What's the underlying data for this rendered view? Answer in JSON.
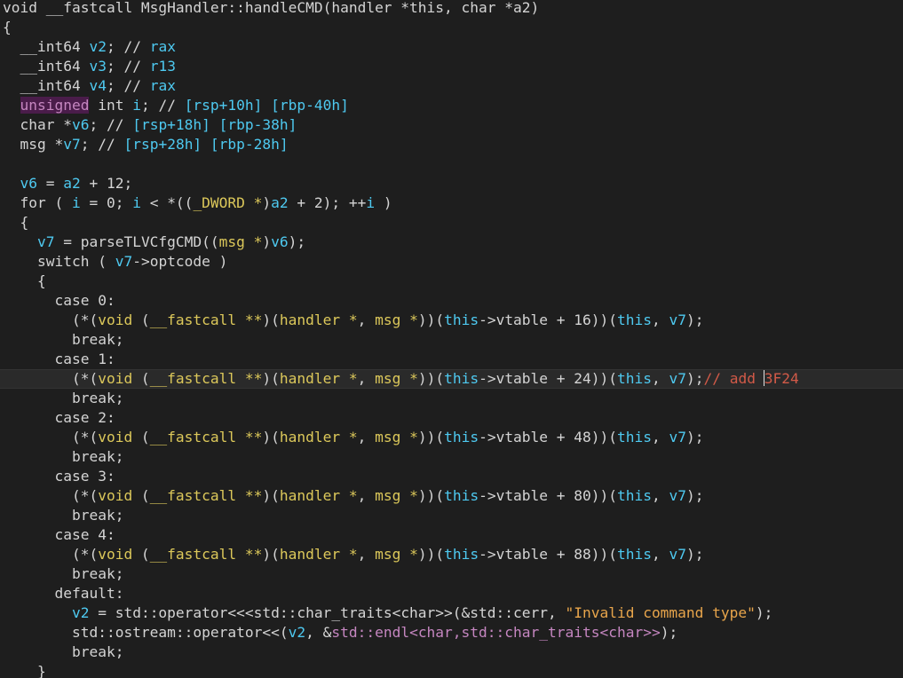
{
  "editor": {
    "title": "",
    "background": "#1e1e1e",
    "current_line_background": "#2a2a2a",
    "selection_background": "#4a1c4a",
    "colors": {
      "plain": "#d4d4d4",
      "variable": "#4ec9f0",
      "type": "#dcc85a",
      "keyword_purple": "#c586c0",
      "string": "#e8a54b",
      "comment": "#d25a48"
    },
    "current_line_index": 19,
    "caret": {
      "line": 19,
      "col": 88
    }
  },
  "code": {
    "lines": [
      {
        "tokens": [
          {
            "t": "void __fastcall MsgHandler::handleCMD(handler *this, char *a2)",
            "c": "#d4d4d4"
          }
        ]
      },
      {
        "tokens": [
          {
            "t": "{",
            "c": "#d4d4d4"
          }
        ]
      },
      {
        "tokens": [
          {
            "t": "  __int64 ",
            "c": "#d4d4d4"
          },
          {
            "t": "v2",
            "c": "#4ec9f0"
          },
          {
            "t": "; // ",
            "c": "#d4d4d4"
          },
          {
            "t": "rax",
            "c": "#4ec9f0"
          }
        ]
      },
      {
        "tokens": [
          {
            "t": "  __int64 ",
            "c": "#d4d4d4"
          },
          {
            "t": "v3",
            "c": "#4ec9f0"
          },
          {
            "t": "; // ",
            "c": "#d4d4d4"
          },
          {
            "t": "r13",
            "c": "#4ec9f0"
          }
        ]
      },
      {
        "tokens": [
          {
            "t": "  __int64 ",
            "c": "#d4d4d4"
          },
          {
            "t": "v4",
            "c": "#4ec9f0"
          },
          {
            "t": "; // ",
            "c": "#d4d4d4"
          },
          {
            "t": "rax",
            "c": "#4ec9f0"
          }
        ]
      },
      {
        "tokens": [
          {
            "t": "  ",
            "c": "#d4d4d4"
          },
          {
            "t": "unsigned",
            "c": "#c586c0",
            "hl": true
          },
          {
            "t": " int ",
            "c": "#d4d4d4"
          },
          {
            "t": "i",
            "c": "#4ec9f0"
          },
          {
            "t": "; // ",
            "c": "#d4d4d4"
          },
          {
            "t": "[rsp+10h] [rbp-40h]",
            "c": "#4ec9f0"
          }
        ]
      },
      {
        "tokens": [
          {
            "t": "  char *",
            "c": "#d4d4d4"
          },
          {
            "t": "v6",
            "c": "#4ec9f0"
          },
          {
            "t": "; // ",
            "c": "#d4d4d4"
          },
          {
            "t": "[rsp+18h] [rbp-38h]",
            "c": "#4ec9f0"
          }
        ]
      },
      {
        "tokens": [
          {
            "t": "  msg *",
            "c": "#d4d4d4"
          },
          {
            "t": "v7",
            "c": "#4ec9f0"
          },
          {
            "t": "; // ",
            "c": "#d4d4d4"
          },
          {
            "t": "[rsp+28h] [rbp-28h]",
            "c": "#4ec9f0"
          }
        ]
      },
      {
        "tokens": [
          {
            "t": "",
            "c": "#d4d4d4"
          }
        ]
      },
      {
        "tokens": [
          {
            "t": "  ",
            "c": "#d4d4d4"
          },
          {
            "t": "v6",
            "c": "#4ec9f0"
          },
          {
            "t": " = ",
            "c": "#d4d4d4"
          },
          {
            "t": "a2",
            "c": "#4ec9f0"
          },
          {
            "t": " + 12;",
            "c": "#d4d4d4"
          }
        ]
      },
      {
        "tokens": [
          {
            "t": "  for ( ",
            "c": "#d4d4d4"
          },
          {
            "t": "i",
            "c": "#4ec9f0"
          },
          {
            "t": " = 0; ",
            "c": "#d4d4d4"
          },
          {
            "t": "i",
            "c": "#4ec9f0"
          },
          {
            "t": " < *((",
            "c": "#d4d4d4"
          },
          {
            "t": "_DWORD *",
            "c": "#dcc85a"
          },
          {
            "t": ")",
            "c": "#d4d4d4"
          },
          {
            "t": "a2",
            "c": "#4ec9f0"
          },
          {
            "t": " + 2); ++",
            "c": "#d4d4d4"
          },
          {
            "t": "i",
            "c": "#4ec9f0"
          },
          {
            "t": " )",
            "c": "#d4d4d4"
          }
        ]
      },
      {
        "tokens": [
          {
            "t": "  {",
            "c": "#d4d4d4"
          }
        ]
      },
      {
        "tokens": [
          {
            "t": "    ",
            "c": "#d4d4d4"
          },
          {
            "t": "v7",
            "c": "#4ec9f0"
          },
          {
            "t": " = parseTLVCfgCMD((",
            "c": "#d4d4d4"
          },
          {
            "t": "msg *",
            "c": "#dcc85a"
          },
          {
            "t": ")",
            "c": "#d4d4d4"
          },
          {
            "t": "v6",
            "c": "#4ec9f0"
          },
          {
            "t": ");",
            "c": "#d4d4d4"
          }
        ]
      },
      {
        "tokens": [
          {
            "t": "    switch ( ",
            "c": "#d4d4d4"
          },
          {
            "t": "v7",
            "c": "#4ec9f0"
          },
          {
            "t": "->optcode )",
            "c": "#d4d4d4"
          }
        ]
      },
      {
        "tokens": [
          {
            "t": "    {",
            "c": "#d4d4d4"
          }
        ]
      },
      {
        "tokens": [
          {
            "t": "      case 0:",
            "c": "#d4d4d4"
          }
        ]
      },
      {
        "tokens": [
          {
            "t": "        (*(",
            "c": "#d4d4d4"
          },
          {
            "t": "void",
            "c": "#dcc85a"
          },
          {
            "t": " (",
            "c": "#d4d4d4"
          },
          {
            "t": "__fastcall **",
            "c": "#dcc85a"
          },
          {
            "t": ")(",
            "c": "#d4d4d4"
          },
          {
            "t": "handler *",
            "c": "#dcc85a"
          },
          {
            "t": ", ",
            "c": "#d4d4d4"
          },
          {
            "t": "msg *",
            "c": "#dcc85a"
          },
          {
            "t": "))(",
            "c": "#d4d4d4"
          },
          {
            "t": "this",
            "c": "#4ec9f0"
          },
          {
            "t": "->vtable + 16))(",
            "c": "#d4d4d4"
          },
          {
            "t": "this",
            "c": "#4ec9f0"
          },
          {
            "t": ", ",
            "c": "#d4d4d4"
          },
          {
            "t": "v7",
            "c": "#4ec9f0"
          },
          {
            "t": ");",
            "c": "#d4d4d4"
          }
        ]
      },
      {
        "tokens": [
          {
            "t": "        break;",
            "c": "#d4d4d4"
          }
        ]
      },
      {
        "tokens": [
          {
            "t": "      case 1:",
            "c": "#d4d4d4"
          }
        ]
      },
      {
        "tokens": [
          {
            "t": "        (*(",
            "c": "#d4d4d4"
          },
          {
            "t": "void",
            "c": "#dcc85a"
          },
          {
            "t": " (",
            "c": "#d4d4d4"
          },
          {
            "t": "__fastcall **",
            "c": "#dcc85a"
          },
          {
            "t": ")(",
            "c": "#d4d4d4"
          },
          {
            "t": "handler *",
            "c": "#dcc85a"
          },
          {
            "t": ", ",
            "c": "#d4d4d4"
          },
          {
            "t": "msg *",
            "c": "#dcc85a"
          },
          {
            "t": "))(",
            "c": "#d4d4d4"
          },
          {
            "t": "this",
            "c": "#4ec9f0"
          },
          {
            "t": "->vtable + 24))(",
            "c": "#d4d4d4"
          },
          {
            "t": "this",
            "c": "#4ec9f0"
          },
          {
            "t": ", ",
            "c": "#d4d4d4"
          },
          {
            "t": "v7",
            "c": "#4ec9f0"
          },
          {
            "t": ");",
            "c": "#d4d4d4"
          },
          {
            "t": "// add 3F24",
            "c": "#d25a48"
          }
        ]
      },
      {
        "tokens": [
          {
            "t": "        break;",
            "c": "#d4d4d4"
          }
        ]
      },
      {
        "tokens": [
          {
            "t": "      case 2:",
            "c": "#d4d4d4"
          }
        ]
      },
      {
        "tokens": [
          {
            "t": "        (*(",
            "c": "#d4d4d4"
          },
          {
            "t": "void",
            "c": "#dcc85a"
          },
          {
            "t": " (",
            "c": "#d4d4d4"
          },
          {
            "t": "__fastcall **",
            "c": "#dcc85a"
          },
          {
            "t": ")(",
            "c": "#d4d4d4"
          },
          {
            "t": "handler *",
            "c": "#dcc85a"
          },
          {
            "t": ", ",
            "c": "#d4d4d4"
          },
          {
            "t": "msg *",
            "c": "#dcc85a"
          },
          {
            "t": "))(",
            "c": "#d4d4d4"
          },
          {
            "t": "this",
            "c": "#4ec9f0"
          },
          {
            "t": "->vtable + 48))(",
            "c": "#d4d4d4"
          },
          {
            "t": "this",
            "c": "#4ec9f0"
          },
          {
            "t": ", ",
            "c": "#d4d4d4"
          },
          {
            "t": "v7",
            "c": "#4ec9f0"
          },
          {
            "t": ");",
            "c": "#d4d4d4"
          }
        ]
      },
      {
        "tokens": [
          {
            "t": "        break;",
            "c": "#d4d4d4"
          }
        ]
      },
      {
        "tokens": [
          {
            "t": "      case 3:",
            "c": "#d4d4d4"
          }
        ]
      },
      {
        "tokens": [
          {
            "t": "        (*(",
            "c": "#d4d4d4"
          },
          {
            "t": "void",
            "c": "#dcc85a"
          },
          {
            "t": " (",
            "c": "#d4d4d4"
          },
          {
            "t": "__fastcall **",
            "c": "#dcc85a"
          },
          {
            "t": ")(",
            "c": "#d4d4d4"
          },
          {
            "t": "handler *",
            "c": "#dcc85a"
          },
          {
            "t": ", ",
            "c": "#d4d4d4"
          },
          {
            "t": "msg *",
            "c": "#dcc85a"
          },
          {
            "t": "))(",
            "c": "#d4d4d4"
          },
          {
            "t": "this",
            "c": "#4ec9f0"
          },
          {
            "t": "->vtable + 80))(",
            "c": "#d4d4d4"
          },
          {
            "t": "this",
            "c": "#4ec9f0"
          },
          {
            "t": ", ",
            "c": "#d4d4d4"
          },
          {
            "t": "v7",
            "c": "#4ec9f0"
          },
          {
            "t": ");",
            "c": "#d4d4d4"
          }
        ]
      },
      {
        "tokens": [
          {
            "t": "        break;",
            "c": "#d4d4d4"
          }
        ]
      },
      {
        "tokens": [
          {
            "t": "      case 4:",
            "c": "#d4d4d4"
          }
        ]
      },
      {
        "tokens": [
          {
            "t": "        (*(",
            "c": "#d4d4d4"
          },
          {
            "t": "void",
            "c": "#dcc85a"
          },
          {
            "t": " (",
            "c": "#d4d4d4"
          },
          {
            "t": "__fastcall **",
            "c": "#dcc85a"
          },
          {
            "t": ")(",
            "c": "#d4d4d4"
          },
          {
            "t": "handler *",
            "c": "#dcc85a"
          },
          {
            "t": ", ",
            "c": "#d4d4d4"
          },
          {
            "t": "msg *",
            "c": "#dcc85a"
          },
          {
            "t": "))(",
            "c": "#d4d4d4"
          },
          {
            "t": "this",
            "c": "#4ec9f0"
          },
          {
            "t": "->vtable + 88))(",
            "c": "#d4d4d4"
          },
          {
            "t": "this",
            "c": "#4ec9f0"
          },
          {
            "t": ", ",
            "c": "#d4d4d4"
          },
          {
            "t": "v7",
            "c": "#4ec9f0"
          },
          {
            "t": ");",
            "c": "#d4d4d4"
          }
        ]
      },
      {
        "tokens": [
          {
            "t": "        break;",
            "c": "#d4d4d4"
          }
        ]
      },
      {
        "tokens": [
          {
            "t": "      default:",
            "c": "#d4d4d4"
          }
        ]
      },
      {
        "tokens": [
          {
            "t": "        ",
            "c": "#d4d4d4"
          },
          {
            "t": "v2",
            "c": "#4ec9f0"
          },
          {
            "t": " = std::operator<<<std::char_traits<char>>(&std::cerr, ",
            "c": "#d4d4d4"
          },
          {
            "t": "\"Invalid command type\"",
            "c": "#e8a54b"
          },
          {
            "t": ");",
            "c": "#d4d4d4"
          }
        ]
      },
      {
        "tokens": [
          {
            "t": "        std::ostream::operator<<(",
            "c": "#d4d4d4"
          },
          {
            "t": "v2",
            "c": "#4ec9f0"
          },
          {
            "t": ", &",
            "c": "#d4d4d4"
          },
          {
            "t": "std::endl<char,std::char_traits<char>>",
            "c": "#c586c0"
          },
          {
            "t": ");",
            "c": "#d4d4d4"
          }
        ]
      },
      {
        "tokens": [
          {
            "t": "        break;",
            "c": "#d4d4d4"
          }
        ]
      },
      {
        "tokens": [
          {
            "t": "    }",
            "c": "#d4d4d4"
          }
        ]
      }
    ]
  }
}
